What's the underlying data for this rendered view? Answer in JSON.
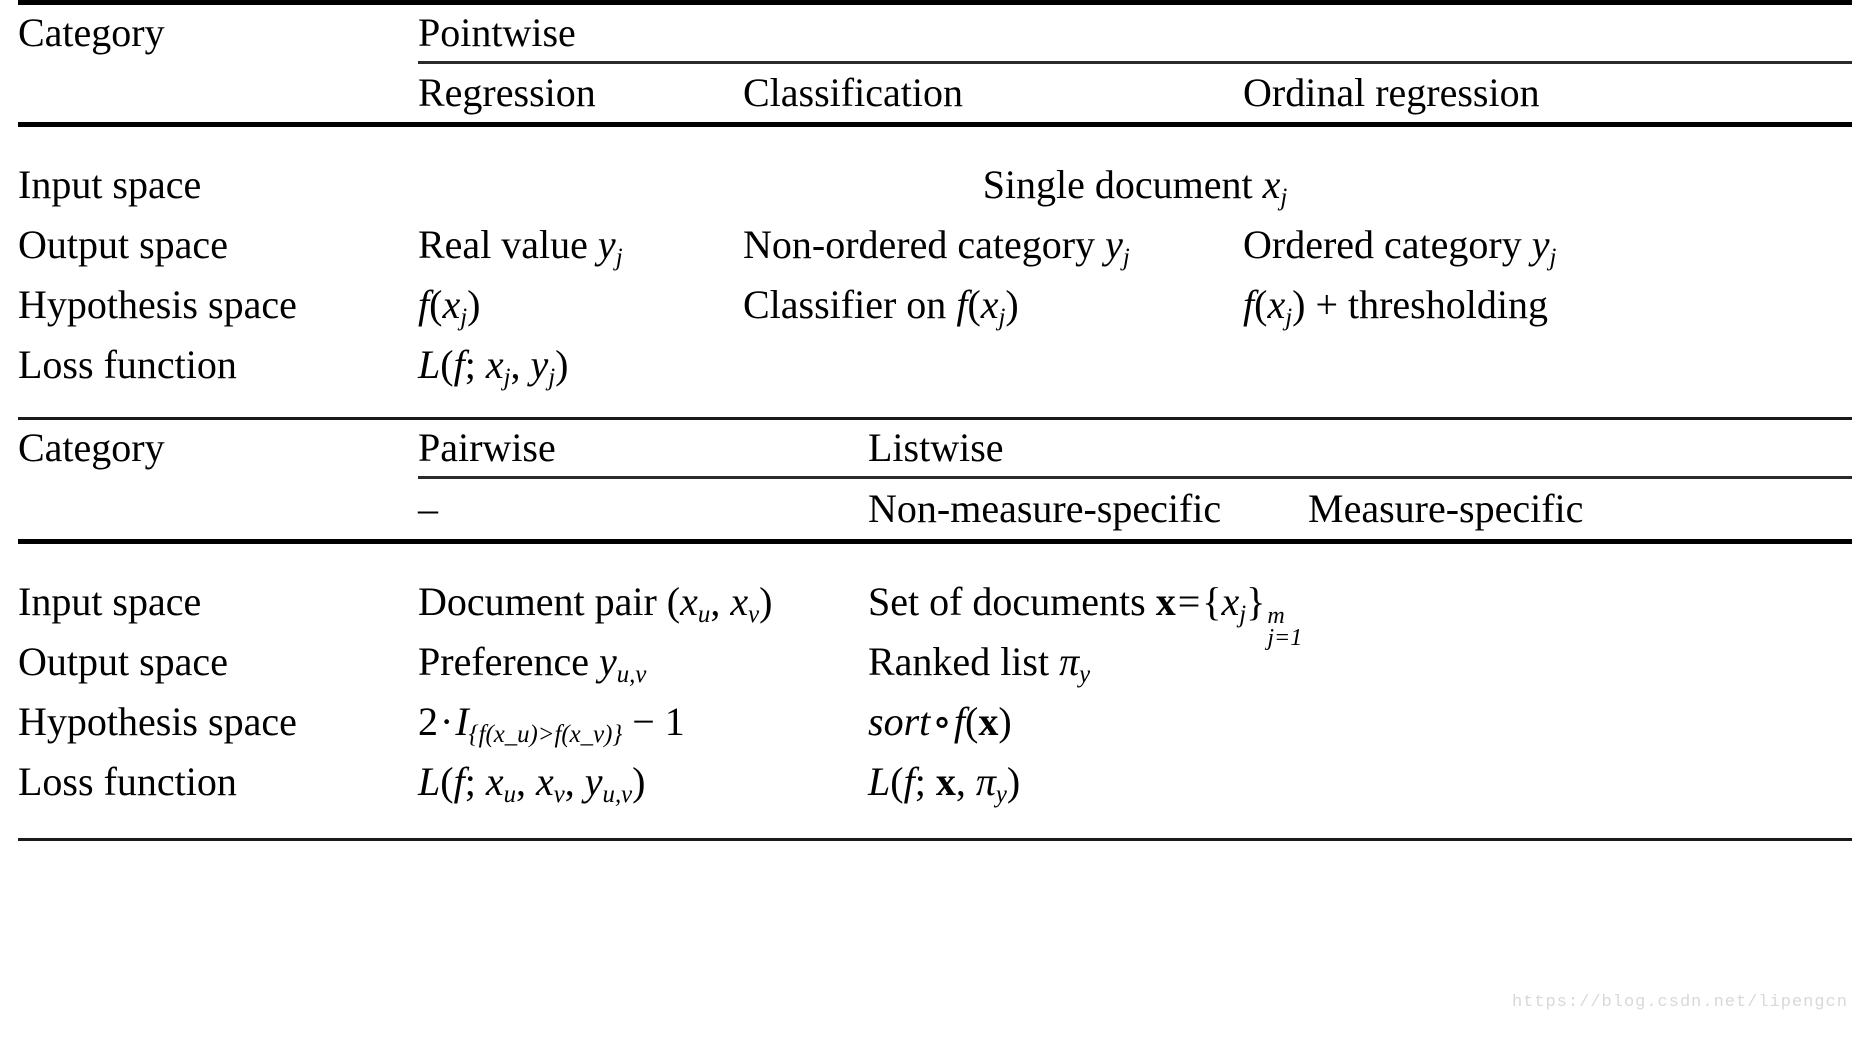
{
  "document": {
    "type": "academic-table",
    "watermark": "https://blog.csdn.net/lipengcn"
  },
  "table1": {
    "row_label_header": "Category",
    "group_header": "Pointwise",
    "columns": [
      "Regression",
      "Classification",
      "Ordinal regression"
    ],
    "row_labels": [
      "Input space",
      "Output space",
      "Hypothesis space",
      "Loss function"
    ],
    "rows": {
      "input_space": {
        "spanned": true,
        "value_plain": "Single document x_j",
        "value_lead": "Single document ",
        "value_var": "x",
        "value_sub": "j"
      },
      "output_space": {
        "regression_lead": "Real value ",
        "regression_var": "y",
        "regression_sub": "j",
        "classification_lead": "Non-ordered category ",
        "classification_var": "y",
        "classification_sub": "j",
        "ordinal_lead": "Ordered category ",
        "ordinal_var": "y",
        "ordinal_sub": "j"
      },
      "hypothesis_space": {
        "regression_plain": "f(x_j)",
        "classification_lead": "Classifier on ",
        "classification_plain": "f(x_j)",
        "ordinal_plain": "f(x_j) + thresholding",
        "ordinal_tail": " + thresholding"
      },
      "loss_function": {
        "regression_plain": "L(f; x_j, y_j)"
      }
    }
  },
  "table2": {
    "row_label_header": "Category",
    "group_headers": [
      "Pairwise",
      "Listwise"
    ],
    "columns": [
      "–",
      "Non-measure-specific",
      "Measure-specific"
    ],
    "row_labels": [
      "Input space",
      "Output space",
      "Hypothesis space",
      "Loss function"
    ],
    "rows": {
      "input_space": {
        "pairwise_lead": "Document pair (",
        "pairwise_plain": "Document pair (x_u, x_v)",
        "listwise_lead": "Set of documents ",
        "listwise_plain": "Set of documents x = {x_j}_{j=1}^m",
        "listwise_sup": "m",
        "listwise_subscript": "j=1"
      },
      "output_space": {
        "pairwise_lead": "Preference ",
        "pairwise_var": "y",
        "pairwise_sub": "u,v",
        "listwise_lead": "Ranked list ",
        "listwise_var": "π",
        "listwise_sub": "y"
      },
      "hypothesis_space": {
        "pairwise_plain": "2 · I_{f(x_u)>f(x_v)} − 1",
        "pairwise_prefix": "2",
        "pairwise_dot": "·",
        "pairwise_ind": "I",
        "pairwise_cond": "{f(x_u)>f(x_v)}",
        "pairwise_suffix": "− 1",
        "listwise_plain": "sort ∘ f(x)",
        "listwise_sort": "sort",
        "listwise_circ": "∘"
      },
      "loss_function": {
        "pairwise_plain": "L(f; x_u, x_v, y_u,v)",
        "listwise_plain": "L(f; x, π_y)"
      }
    }
  }
}
